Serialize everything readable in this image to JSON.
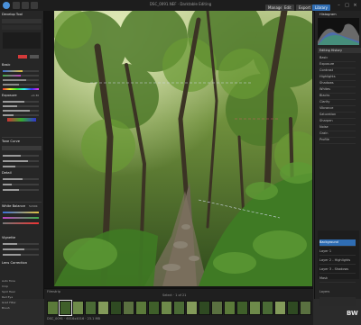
{
  "app": {
    "title": "DSC_0091.NEF · Darktable Editing",
    "brand_color": "#4a90d9"
  },
  "top_tabs": [
    {
      "label": "Manage"
    },
    {
      "label": "Edit"
    },
    {
      "label": "Export"
    },
    {
      "label": "Library"
    }
  ],
  "left_panel": {
    "title": "Develop Tool",
    "sections": [
      {
        "label": "Basic",
        "value": ""
      },
      {
        "label": "Exposure",
        "value": "+0.30"
      },
      {
        "label": "Tone Curve",
        "value": ""
      },
      {
        "label": "Detail",
        "value": ""
      },
      {
        "label": "White Balance",
        "value": "5200K"
      },
      {
        "label": "Vignette",
        "value": ""
      },
      {
        "label": "Lens Correction",
        "value": ""
      }
    ],
    "checks": [
      "Auto Tone",
      "Crop",
      "Spot Heal",
      "Red Eye",
      "Grad Filter",
      "Brush"
    ]
  },
  "right_panel": {
    "title": "Histogram",
    "list_title": "Editing History",
    "items": [
      "Basic",
      "Exposure",
      "Contrast",
      "Highlights",
      "Shadows",
      "Whites",
      "Blacks",
      "Clarity",
      "Vibrance",
      "Saturation",
      "Sharpen",
      "Noise",
      "Grain",
      "Profile"
    ],
    "layers": [
      {
        "label": "Background",
        "selected": true
      },
      {
        "label": "Layer 1",
        "selected": false
      },
      {
        "label": "Layer 2 - Highlights",
        "selected": false
      },
      {
        "label": "Layer 3 - Shadows",
        "selected": false
      },
      {
        "label": "Mask",
        "selected": false
      }
    ],
    "footer_label": "Layers"
  },
  "filmstrip": {
    "label": "Filmstrip",
    "center": "Select · 1 of 21",
    "status": "DSC_0091 · 6016x4016 · 23.1 MB",
    "count": 21
  },
  "corner_badge": "BW"
}
